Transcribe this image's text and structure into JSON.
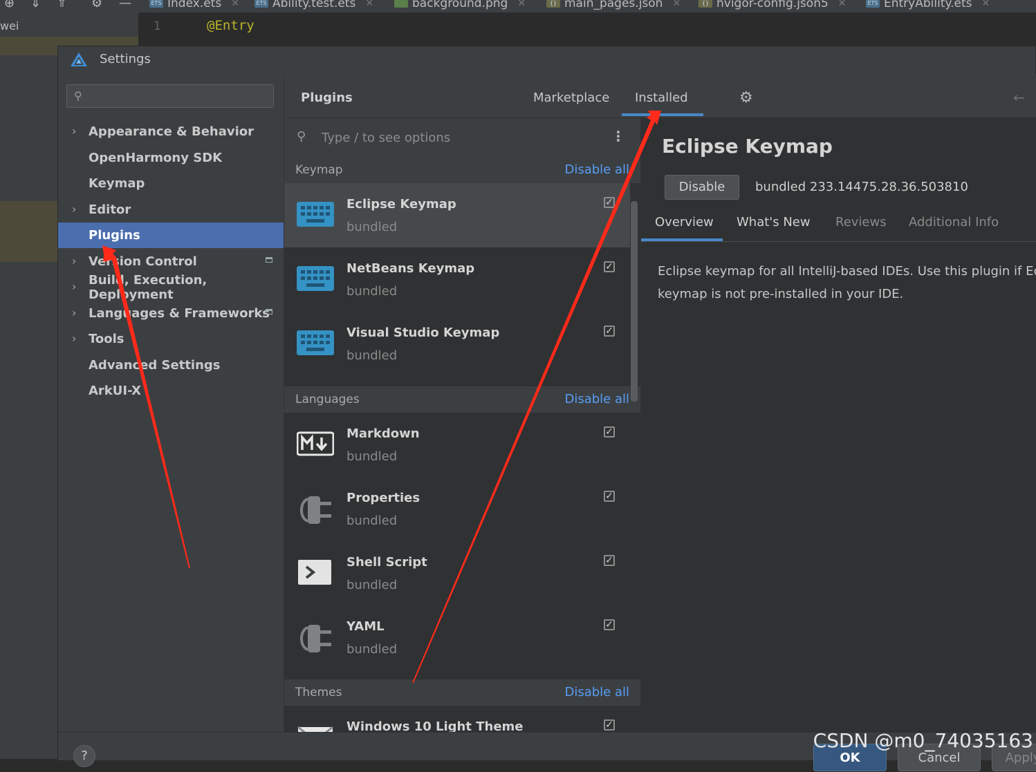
{
  "ide": {
    "tabs": [
      {
        "label": "Index.ets",
        "type": "ETS"
      },
      {
        "label": "Ability.test.ets",
        "type": "ETS"
      },
      {
        "label": "background.png",
        "type": "PNG"
      },
      {
        "label": "main_pages.json",
        "type": "{}"
      },
      {
        "label": "hvigor-config.json5",
        "type": "{}"
      },
      {
        "label": "EntryAbility.ets",
        "type": "ETS"
      }
    ],
    "project_label": "wei",
    "line_number": "1",
    "code_line": "@Entry"
  },
  "dialog": {
    "title": "Settings",
    "search_placeholder": "",
    "nav": [
      {
        "label": "Appearance & Behavior",
        "chevron": true
      },
      {
        "label": "OpenHarmony SDK",
        "chevron": false
      },
      {
        "label": "Keymap",
        "chevron": false
      },
      {
        "label": "Editor",
        "chevron": true
      },
      {
        "label": "Plugins",
        "chevron": false,
        "selected": true
      },
      {
        "label": "Version Control",
        "chevron": true,
        "badge": true
      },
      {
        "label": "Build, Execution, Deployment",
        "chevron": true
      },
      {
        "label": "Languages & Frameworks",
        "chevron": true,
        "badge": true
      },
      {
        "label": "Tools",
        "chevron": true
      },
      {
        "label": "Advanced Settings",
        "chevron": false
      },
      {
        "label": "ArkUI-X",
        "chevron": false
      }
    ],
    "plugins": {
      "title": "Plugins",
      "tab_marketplace": "Marketplace",
      "tab_installed": "Installed",
      "active_tab": "Installed",
      "list_search_placeholder": "Type / to see options",
      "disable_all": "Disable all",
      "groups": {
        "keymap": {
          "name": "Keymap"
        },
        "languages": {
          "name": "Languages"
        },
        "themes": {
          "name": "Themes"
        }
      },
      "items": [
        {
          "name": "Eclipse Keymap",
          "status": "bundled",
          "icon": "keyboard-icon",
          "checked": true,
          "selected": true
        },
        {
          "name": "NetBeans Keymap",
          "status": "bundled",
          "icon": "keyboard-icon",
          "checked": true
        },
        {
          "name": "Visual Studio Keymap",
          "status": "bundled",
          "icon": "keyboard-icon",
          "checked": true
        },
        {
          "name": "Markdown",
          "status": "bundled",
          "icon": "markdown-icon",
          "checked": true
        },
        {
          "name": "Properties",
          "status": "bundled",
          "icon": "plugin-plug-icon",
          "checked": true
        },
        {
          "name": "Shell Script",
          "status": "bundled",
          "icon": "terminal-icon",
          "checked": true
        },
        {
          "name": "YAML",
          "status": "bundled",
          "icon": "plugin-plug-icon",
          "checked": true
        },
        {
          "name": "Windows 10 Light Theme",
          "status": "",
          "icon": "theme-icon",
          "checked": true
        }
      ]
    },
    "detail": {
      "title": "Eclipse Keymap",
      "button": "Disable",
      "version": "bundled 233.14475.28.36.503810",
      "tabs": [
        "Overview",
        "What's New",
        "Reviews",
        "Additional Info"
      ],
      "active_tab": "Overview",
      "desc_line1": "Eclipse keymap for all IntelliJ-based IDEs. Use this plugin if Eclip",
      "desc_line2": "keymap is not pre-installed in your IDE."
    },
    "footer": {
      "help": "?",
      "ok": "OK",
      "cancel": "Cancel",
      "apply": "Apply"
    }
  },
  "watermark": "CSDN @m0_74035163",
  "colors": {
    "accent": "#4b6eaf",
    "link": "#589df6",
    "annotation_arrow": "#ff2a1a"
  }
}
